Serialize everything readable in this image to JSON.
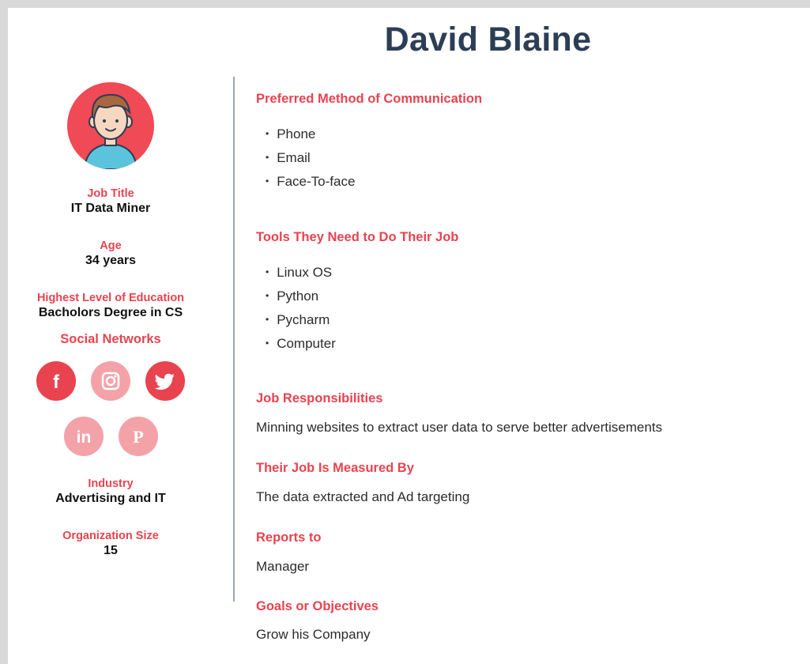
{
  "persona": {
    "name": "David Blaine",
    "sidebar": {
      "fields_top": [
        {
          "label": "Job Title",
          "value": "IT Data Miner"
        },
        {
          "label": "Age",
          "value": "34 years"
        },
        {
          "label": "Highest Level of Education",
          "value": "Bacholors Degree in CS"
        }
      ],
      "social_title": "Social Networks",
      "social": [
        {
          "name": "facebook",
          "glyph": "f",
          "tone": "dark"
        },
        {
          "name": "instagram",
          "glyph": "",
          "tone": "light"
        },
        {
          "name": "twitter",
          "glyph": "",
          "tone": "dark"
        },
        {
          "name": "linkedin",
          "glyph": "in",
          "tone": "light"
        },
        {
          "name": "pinterest",
          "glyph": "P",
          "tone": "light"
        }
      ],
      "fields_bottom": [
        {
          "label": "Industry",
          "value": "Advertising and IT"
        },
        {
          "label": "Organization Size",
          "value": "15"
        }
      ]
    },
    "sections": {
      "communication": {
        "title": "Preferred Method of Communication",
        "items": [
          "Phone",
          "Email",
          "Face-To-face"
        ]
      },
      "tools": {
        "title": "Tools They Need to Do Their Job",
        "items": [
          "Linux OS",
          "Python",
          "Pycharm",
          "Computer"
        ]
      },
      "responsibilities": {
        "title": "Job Responsibilities",
        "text": "Minning websites to extract user data to serve better advertisements"
      },
      "measured": {
        "title": "Their Job Is Measured By",
        "text": "The data extracted and Ad targeting"
      },
      "reports": {
        "title": "Reports to",
        "text": "Manager"
      },
      "goals": {
        "title": "Goals or Objectives",
        "text": "Grow his Company"
      }
    }
  },
  "colors": {
    "accent": "#e8434f",
    "accent_light": "#f3a3a8",
    "title": "#2c3e55",
    "divider": "#9aa6b5"
  }
}
